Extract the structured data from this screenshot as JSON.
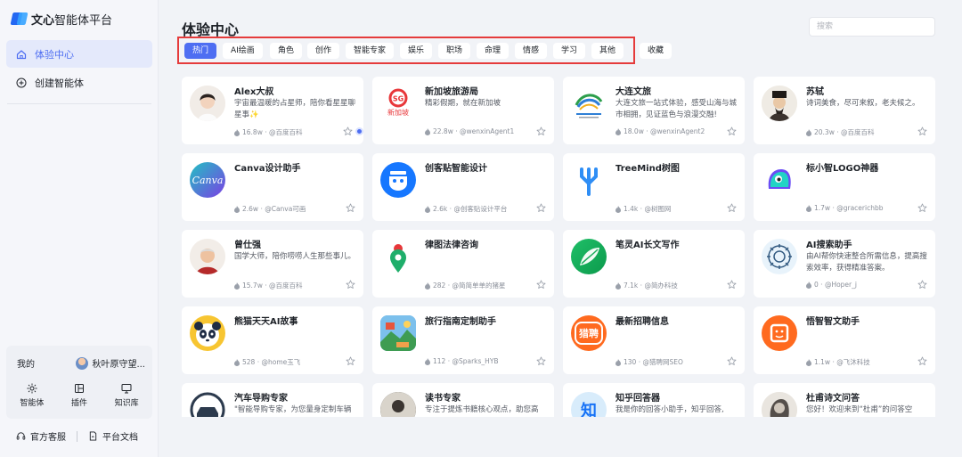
{
  "app": {
    "logo_bold": "文心",
    "logo_rest": "智能体平台"
  },
  "sidebar": {
    "items": [
      {
        "label": "体验中心",
        "icon": "home-icon",
        "active": true
      },
      {
        "label": "创建智能体",
        "icon": "plus-circle-icon",
        "active": false
      }
    ],
    "me": {
      "label": "我的",
      "user": "秋叶原守望...",
      "tools": [
        {
          "label": "智能体",
          "icon": "sparkle-icon"
        },
        {
          "label": "插件",
          "icon": "plugin-icon"
        },
        {
          "label": "知识库",
          "icon": "monitor-icon"
        }
      ]
    },
    "footer": {
      "support": "官方客服",
      "docs": "平台文档"
    }
  },
  "main": {
    "title": "体验中心",
    "search_placeholder": "搜索",
    "tabs": [
      {
        "label": "热门",
        "active": true
      },
      {
        "label": "AI绘画"
      },
      {
        "label": "角色"
      },
      {
        "label": "创作"
      },
      {
        "label": "智能专家"
      },
      {
        "label": "娱乐"
      },
      {
        "label": "职场"
      },
      {
        "label": "命理"
      },
      {
        "label": "情感"
      },
      {
        "label": "学习"
      },
      {
        "label": "其他"
      },
      {
        "label": "收藏"
      }
    ],
    "cards": [
      {
        "name": "Alex大叔",
        "desc": "宇宙最温暖的占星师，陪你看星星聊星事✨",
        "count": "16.8w",
        "author": "@百度百科"
      },
      {
        "name": "新加坡旅游局",
        "desc": "精彩假期，就在新加坡",
        "count": "22.8w",
        "author": "@wenxinAgent1"
      },
      {
        "name": "大连文旅",
        "desc": "大连文旅一站式体验，感受山海与城市相拥，见证蓝色与浪漫交融!",
        "count": "18.0w",
        "author": "@wenxinAgent2"
      },
      {
        "name": "苏轼",
        "desc": "诗词美食，尽可来叙，老夫候之。",
        "count": "20.3w",
        "author": "@百度百科"
      },
      {
        "name": "Canva设计助手",
        "desc": "",
        "count": "2.6w",
        "author": "@Canva可画"
      },
      {
        "name": "创客贴智能设计",
        "desc": "",
        "count": "2.6k",
        "author": "@创客贴设计平台"
      },
      {
        "name": "TreeMind树图",
        "desc": "",
        "count": "1.4k",
        "author": "@树图网"
      },
      {
        "name": "标小智LOGO神器",
        "desc": "",
        "count": "1.7w",
        "author": "@gracerichbb"
      },
      {
        "name": "曾仕强",
        "desc": "国学大师，陪你唠唠人生那些事儿。",
        "count": "15.7w",
        "author": "@百度百科"
      },
      {
        "name": "律图法律咨询",
        "desc": "",
        "count": "282",
        "author": "@简简单单的猪星"
      },
      {
        "name": "笔灵AI长文写作",
        "desc": "",
        "count": "7.1k",
        "author": "@简办科技"
      },
      {
        "name": "AI搜索助手",
        "desc": "由AI帮你快速整合所需信息，提高搜索效率，获得精准答案。",
        "count": "0",
        "author": "@Hoper_j"
      },
      {
        "name": "熊猫天天AI故事",
        "desc": "",
        "count": "528",
        "author": "@home玉飞"
      },
      {
        "name": "旅行指南定制助手",
        "desc": "",
        "count": "112",
        "author": "@Sparks_HYB"
      },
      {
        "name": "最新招聘信息",
        "desc": "",
        "count": "130",
        "author": "@猎聘网SEO"
      },
      {
        "name": "悟智智文助手",
        "desc": "",
        "count": "1.1w",
        "author": "@飞沐科技"
      },
      {
        "name": "汽车导购专家",
        "desc": "\"智能导购专家，为您量身定制车辆",
        "count": "",
        "author": ""
      },
      {
        "name": "读书专家",
        "desc": "专注于提炼书籍核心观点，助您高",
        "count": "",
        "author": ""
      },
      {
        "name": "知乎回答器",
        "desc": "我是你的回答小助手，知乎回答,",
        "count": "",
        "author": ""
      },
      {
        "name": "杜甫诗文问答",
        "desc": "您好！欢迎来到“杜甫”的问答空",
        "count": "",
        "author": ""
      }
    ],
    "thumb_labels": {
      "singapore": "新加坡",
      "canva": "Canva",
      "liepin": "猎聘",
      "zhihu": "知"
    }
  },
  "colors": {
    "accent": "#4e6ef2",
    "highlight_frame": "#e53b3b"
  }
}
